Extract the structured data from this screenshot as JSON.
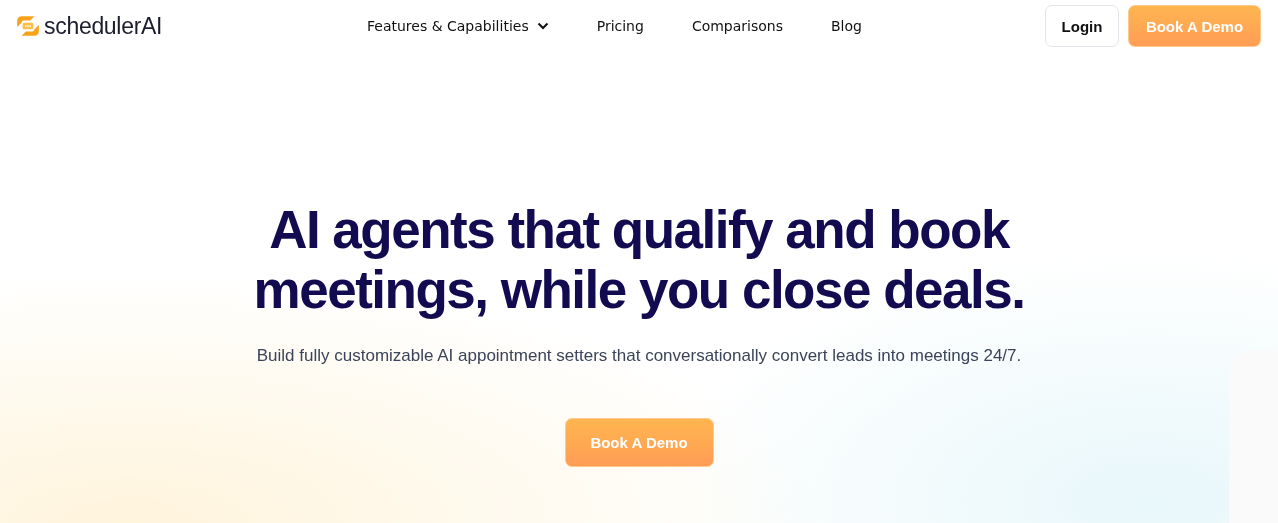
{
  "brand": {
    "name": "schedulerAI"
  },
  "nav": [
    {
      "label": "Features & Capabilities",
      "dropdown": true
    },
    {
      "label": "Pricing",
      "dropdown": false
    },
    {
      "label": "Comparisons",
      "dropdown": false
    },
    {
      "label": "Blog",
      "dropdown": false
    }
  ],
  "header_buttons": [
    {
      "label": "Login",
      "kind": "outline"
    },
    {
      "label": "Book A Demo",
      "kind": "primary"
    }
  ],
  "hero": {
    "title_lines": [
      "AI agents that qualify and book",
      "meetings, while you close deals."
    ],
    "subtitle": "Build fully customizable AI appointment setters that conversationally convert leads into meetings 24/7.",
    "cta": "Book A Demo"
  }
}
